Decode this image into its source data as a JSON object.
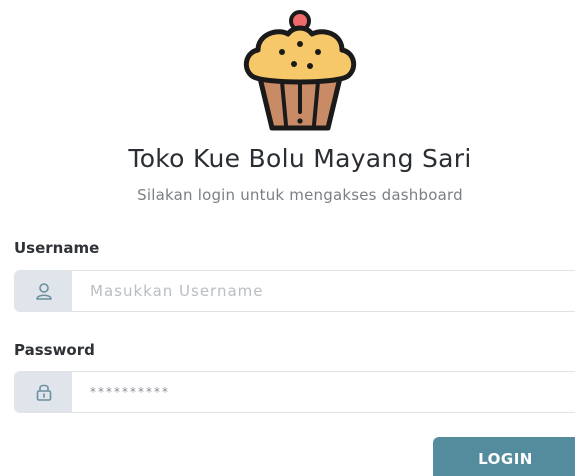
{
  "brand": {
    "title": "Toko Kue Bolu Mayang Sari",
    "subtitle": "Silakan login untuk mengakses dashboard",
    "logo_icon": "cupcake-icon"
  },
  "form": {
    "username": {
      "label": "Username",
      "placeholder": "Masukkan Username",
      "value": "",
      "icon": "user-icon"
    },
    "password": {
      "label": "Password",
      "value": "**********",
      "icon": "lock-icon"
    },
    "submit_label": "LOGIN"
  },
  "colors": {
    "button": "#558c9d",
    "addon_bg": "#dfe5ea",
    "icon": "#6b8fa0"
  }
}
